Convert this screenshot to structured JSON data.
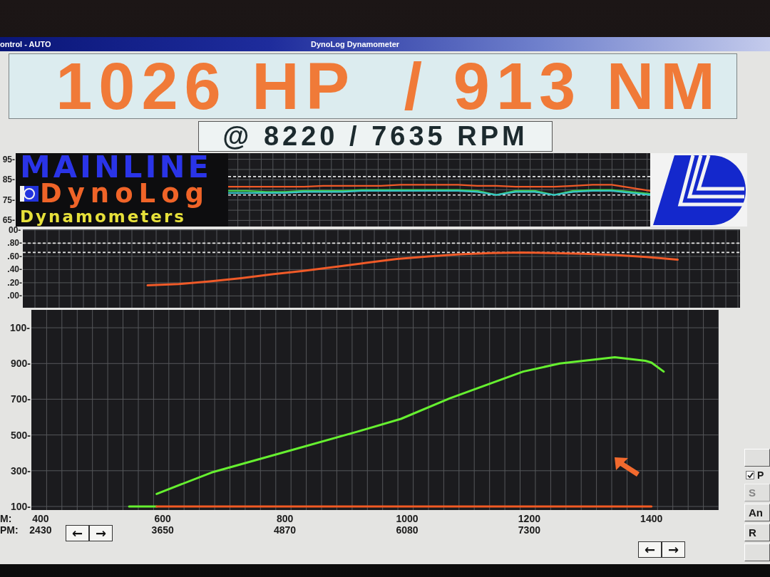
{
  "window": {
    "mode": "ontrol - AUTO",
    "title": "DynoLog Dynamometer"
  },
  "readout": {
    "power_torque": "1026 HP  / 913 NM",
    "rpm": "@ 8220 / 7635 RPM"
  },
  "logo": {
    "wordmark": "MAINLINE",
    "product": "DynoLog",
    "tagline": "Dynamometers"
  },
  "top_chart": {
    "chart_data": {
      "type": "line",
      "categories": [
        null,
        null,
        null,
        null,
        null,
        null,
        null,
        null,
        null,
        null,
        null,
        null,
        null,
        null,
        null,
        null,
        null,
        null,
        null,
        null,
        null,
        null,
        null,
        null,
        null,
        null,
        null,
        null,
        null,
        null,
        null,
        null,
        null,
        null
      ],
      "series": [
        {
          "color": "#f05a28",
          "values": [
            null,
            null,
            null,
            null,
            null,
            null,
            null,
            null,
            null,
            null,
            null,
            81.5,
            81.5,
            81.5,
            81.5,
            81.5,
            82,
            82,
            82,
            82,
            82.5,
            82.5,
            82.5,
            82.5,
            82,
            82,
            81.5,
            81.5,
            81.5,
            82,
            82.5,
            82.5,
            81,
            79.5
          ]
        },
        {
          "color": "#3ccc4a",
          "values": [
            null,
            null,
            null,
            null,
            null,
            null,
            null,
            null,
            null,
            null,
            null,
            79.5,
            79.5,
            79,
            79,
            79.5,
            79.5,
            79.5,
            80,
            80,
            80,
            80,
            80,
            80,
            79.5,
            77.5,
            79.5,
            79.5,
            77.5,
            79.5,
            80,
            80,
            79,
            78
          ]
        },
        {
          "color": "#38c4c8",
          "values": [
            null,
            null,
            null,
            null,
            null,
            null,
            null,
            null,
            null,
            null,
            null,
            78.5,
            78.5,
            78.5,
            78.5,
            79,
            79,
            79,
            79.5,
            79.5,
            79.5,
            79.5,
            79.5,
            79.5,
            79,
            77.5,
            79,
            79,
            77.5,
            79,
            79.5,
            79.5,
            78.5,
            77.5
          ]
        }
      ],
      "ylim": [
        62,
        98
      ],
      "yticks": [
        {
          "value": 95,
          "label": "95-"
        },
        {
          "value": 85,
          "label": "85-"
        },
        {
          "value": 75,
          "label": "75-"
        },
        {
          "value": 65,
          "label": "65-"
        }
      ],
      "ref_lines": [
        {
          "axis": "y",
          "value": 86.5
        },
        {
          "axis": "y",
          "value": 77.5
        }
      ],
      "grid": true
    }
  },
  "middle_chart": {
    "clipped_tick_label": "00-",
    "chart_data": {
      "type": "line",
      "categories": [
        null,
        null,
        null,
        null,
        null,
        null,
        null,
        null,
        null,
        null,
        null,
        null,
        null,
        null,
        null,
        null,
        null,
        null,
        null,
        null,
        null,
        null,
        null,
        null
      ],
      "series": [
        {
          "color": "#f05a28",
          "values": [
            null,
            null,
            null,
            null,
            0.16,
            0.18,
            0.22,
            0.27,
            0.33,
            0.38,
            0.44,
            0.5,
            0.56,
            0.6,
            0.63,
            0.65,
            0.66,
            0.65,
            0.64,
            0.62,
            0.59,
            0.55,
            null,
            null
          ]
        }
      ],
      "ylim": [
        -0.18,
        1.01
      ],
      "yticks": [
        {
          "value": 0.8,
          "label": ".80-"
        },
        {
          "value": 0.6,
          "label": ".60-"
        },
        {
          "value": 0.4,
          "label": ".40-"
        },
        {
          "value": 0.2,
          "label": ".20-"
        },
        {
          "value": 0,
          "label": ".00-"
        }
      ],
      "ref_lines": [
        {
          "axis": "y",
          "value": 0.8
        },
        {
          "axis": "y",
          "value": 0.66
        }
      ],
      "grid": true
    }
  },
  "main_chart": {
    "clipped_tick_label": "100-",
    "chart_data": {
      "type": "line",
      "x": [
        545,
        590,
        680,
        800,
        920,
        990,
        1070,
        1190,
        1250,
        1340,
        1390,
        1400,
        1420
      ],
      "series": [
        {
          "color": "#66f030",
          "values": [
            null,
            170,
            290,
            405,
            520,
            590,
            705,
            855,
            900,
            935,
            915,
            905,
            855
          ]
        },
        {
          "color": "#66f030",
          "values": [
            100,
            100,
            null,
            null,
            null,
            null,
            null,
            null,
            null,
            null,
            null,
            null,
            null
          ]
        },
        {
          "color": "#f25a24",
          "values": [
            null,
            100,
            100,
            100,
            100,
            100,
            100,
            100,
            100,
            100,
            100,
            100,
            null
          ]
        }
      ],
      "xlim": [
        385,
        1510
      ],
      "ylim": [
        80,
        1200
      ],
      "xticks": [
        {
          "value": 400,
          "label": "400"
        },
        {
          "value": 600,
          "label": "600"
        },
        {
          "value": 800,
          "label": "800"
        },
        {
          "value": 1000,
          "label": "1000"
        },
        {
          "value": 1200,
          "label": "1200"
        },
        {
          "value": 1400,
          "label": "1400"
        }
      ],
      "yticks": [
        {
          "value": 900,
          "label": "900-"
        },
        {
          "value": 700,
          "label": "700-"
        },
        {
          "value": 500,
          "label": "500-"
        },
        {
          "value": 300,
          "label": "300-"
        },
        {
          "value": 100,
          "label": "100-"
        }
      ],
      "grid": true
    },
    "x_caption": "M:",
    "rpm_axis": {
      "caption": "PM:",
      "ticks": [
        "2430",
        "3650",
        "4870",
        "6080",
        "7300"
      ]
    },
    "scroll_buttons_left": [
      "←",
      "→"
    ],
    "scroll_buttons_right": [
      "←",
      "→"
    ]
  },
  "right_panel": {
    "controls": [
      {
        "kind": "button",
        "disabled": false
      },
      {
        "kind": "checkbox",
        "label": "P",
        "checked": true
      },
      {
        "kind": "button",
        "label": "S",
        "disabled": true
      },
      {
        "kind": "button",
        "label": "An",
        "disabled": false
      },
      {
        "kind": "button",
        "label": "R",
        "disabled": false
      },
      {
        "kind": "button",
        "disabled": false
      }
    ]
  }
}
